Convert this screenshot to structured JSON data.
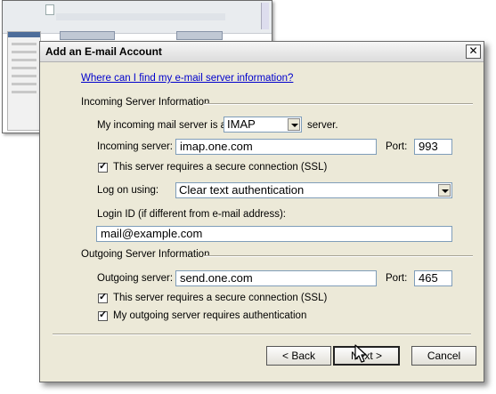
{
  "dialog": {
    "title": "Add an E-mail Account",
    "close_glyph": "✕",
    "help_link": "Where can I find my e-mail server information?"
  },
  "incoming": {
    "section_label": "Incoming Server Information",
    "server_type_prefix": "My incoming mail server is a",
    "server_type": "IMAP",
    "server_type_suffix": "server.",
    "server_label": "Incoming server:",
    "server_value": "imap.one.com",
    "port_label": "Port:",
    "port_value": "993",
    "ssl_label": "This server requires a secure connection (SSL)",
    "ssl_checked": true,
    "logon_label": "Log on using:",
    "logon_value": "Clear text authentication",
    "login_id_label": "Login ID (if different from e-mail address):",
    "login_id_value": "mail@example.com"
  },
  "outgoing": {
    "section_label": "Outgoing Server Information",
    "server_label": "Outgoing server:",
    "server_value": "send.one.com",
    "port_label": "Port:",
    "port_value": "465",
    "ssl_label": "This server requires a secure connection (SSL)",
    "ssl_checked": true,
    "auth_label": "My outgoing server requires authentication",
    "auth_checked": true
  },
  "buttons": {
    "back": "< Back",
    "next": "Next >",
    "cancel": "Cancel"
  }
}
